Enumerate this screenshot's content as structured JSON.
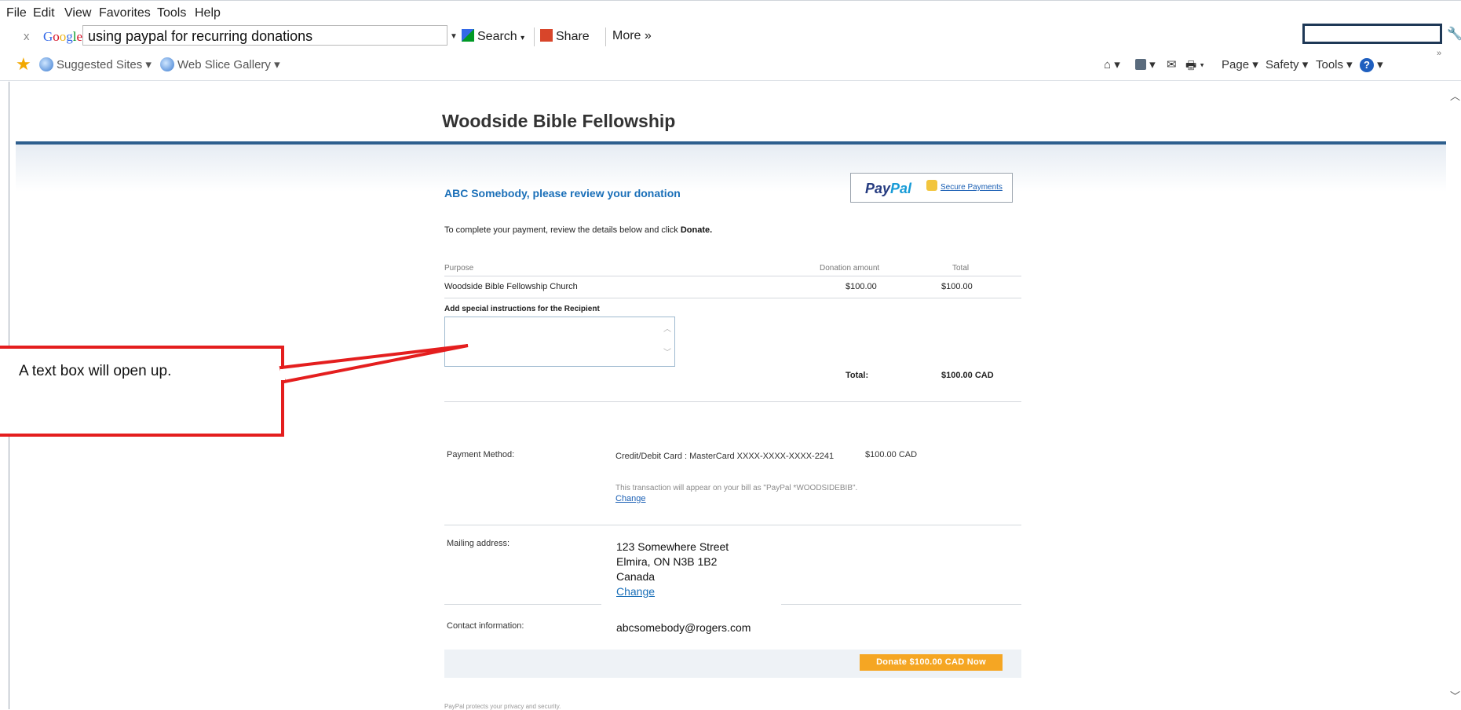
{
  "browser": {
    "menu": [
      "File",
      "Edit",
      "View",
      "Favorites",
      "Tools",
      "Help"
    ],
    "google_toolbar": {
      "close": "x",
      "logo": "Google",
      "query": "using paypal for recurring donations",
      "search_label": "Search",
      "share_label": "Share",
      "more_label": "More »"
    },
    "favorites": {
      "suggested": "Suggested Sites ▾",
      "webslice": "Web Slice Gallery ▾"
    },
    "commands": [
      "Page ▾",
      "Safety ▾",
      "Tools ▾"
    ]
  },
  "page": {
    "site_title": "Woodside Bible Fellowship",
    "review_title": "ABC Somebody, please review your donation",
    "paypal_logo_pay": "Pay",
    "paypal_logo_pal": "Pal",
    "secure_payments": "Secure Payments",
    "instructions_prefix": "To complete your payment, review the details below and click ",
    "instructions_bold": "Donate.",
    "table": {
      "headers": [
        "Purpose",
        "Donation amount",
        "Total"
      ],
      "row": [
        "Woodside Bible Fellowship Church",
        "$100.00",
        "$100.00"
      ]
    },
    "special_instructions_label": "Add special instructions for the Recipient",
    "total_label": "Total:",
    "total_value": "$100.00 CAD",
    "payment_method": {
      "label": "Payment Method:",
      "card": "Credit/Debit Card : MasterCard XXXX-XXXX-XXXX-2241",
      "amount": "$100.00 CAD",
      "note": "This transaction will appear on your bill as \"PayPal *WOODSIDEBIB\".",
      "change": "Change"
    },
    "mailing_address": {
      "label": "Mailing address:",
      "line1": "123 Somewhere Street",
      "line2": "Elmira, ON N3B 1B2",
      "line3": "Canada",
      "change": "Change"
    },
    "contact": {
      "label": "Contact information:",
      "email": "abcsomebody@rogers.com"
    },
    "donate_button": "Donate $100.00 CAD Now",
    "footnote": "PayPal protects your privacy and security."
  },
  "callout": {
    "text": "A text box will open up.",
    "color": "#e41e1e"
  }
}
